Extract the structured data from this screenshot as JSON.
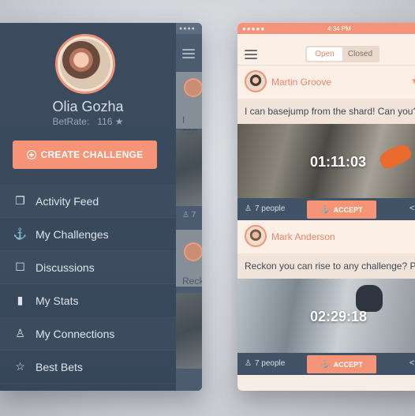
{
  "left": {
    "status_dots": "●●●●",
    "profile": {
      "name": "Olia Gozha",
      "betrate_label": "BetRate:",
      "betrate_value": "116",
      "star": "★"
    },
    "create_button": "CREATE CHALLENGE",
    "menu": [
      {
        "label": "Activity Feed",
        "icon": "activity-feed-icon",
        "glyph": "❐"
      },
      {
        "label": "My Challenges",
        "icon": "anchor-icon",
        "glyph": "⚓"
      },
      {
        "label": "Discussions",
        "icon": "speech-bubble-icon",
        "glyph": "☐"
      },
      {
        "label": "My Stats",
        "icon": "bar-chart-icon",
        "glyph": "▮"
      },
      {
        "label": "My Connections",
        "icon": "person-icon",
        "glyph": "♙"
      },
      {
        "label": "Best Bets",
        "icon": "star-outline-icon",
        "glyph": "☆"
      }
    ],
    "peek": {
      "text1": "I can",
      "text2": "Reck",
      "foot": "♙ 7"
    }
  },
  "right": {
    "status": {
      "dots": "●●●●● ",
      "time": "4:34 PM"
    },
    "tabs": {
      "open": "Open",
      "closed": "Closed"
    },
    "cards": [
      {
        "name": "Martin Groove",
        "text": "I can basejump from the shard! Can you?",
        "time": "01:11:03",
        "people": "7 people",
        "accept": "ACCEPT",
        "star": "★"
      },
      {
        "name": "Mark Anderson",
        "text": "Reckon you can rise to any challenge? Pr",
        "time": "02:29:18",
        "people": "7 people",
        "accept": "ACCEPT",
        "star": ""
      }
    ]
  },
  "colors": {
    "accent": "#f59476",
    "drawer": "#3c4b5e",
    "card_bg": "#fcefe6"
  }
}
